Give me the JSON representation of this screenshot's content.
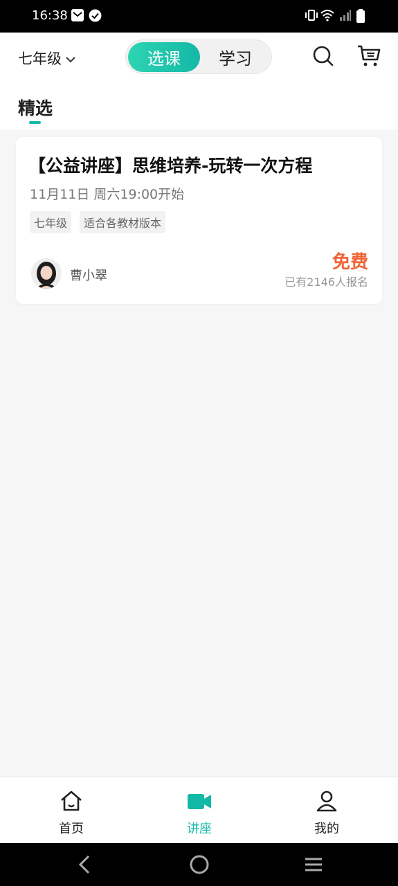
{
  "status_bar": {
    "time": "16:38",
    "left_icons": [
      "mail-icon",
      "check-circle-icon"
    ],
    "right_icons": [
      "vibrate-icon",
      "wifi-icon",
      "signal-icon",
      "battery-icon"
    ]
  },
  "header": {
    "grade": "七年级",
    "tabs": [
      {
        "label": "选课",
        "active": true
      },
      {
        "label": "学习",
        "active": false
      }
    ],
    "icons": [
      "search-icon",
      "cart-icon"
    ]
  },
  "section": {
    "title": "精选"
  },
  "course": {
    "title": "【公益讲座】思维培养-玩转一次方程",
    "time": "11月11日 周六19:00开始",
    "tags": [
      "七年级",
      "适合各教材版本"
    ],
    "teacher": "曹小翠",
    "price": "免费",
    "enrolled": "已有2146人报名"
  },
  "tabbar": {
    "items": [
      {
        "label": "首页",
        "icon": "home-icon",
        "active": false
      },
      {
        "label": "讲座",
        "icon": "video-camera-icon",
        "active": true
      },
      {
        "label": "我的",
        "icon": "user-icon",
        "active": false
      }
    ]
  },
  "colors": {
    "accent": "#14b8a6",
    "price": "#f06436",
    "background": "#f6f6f6"
  }
}
